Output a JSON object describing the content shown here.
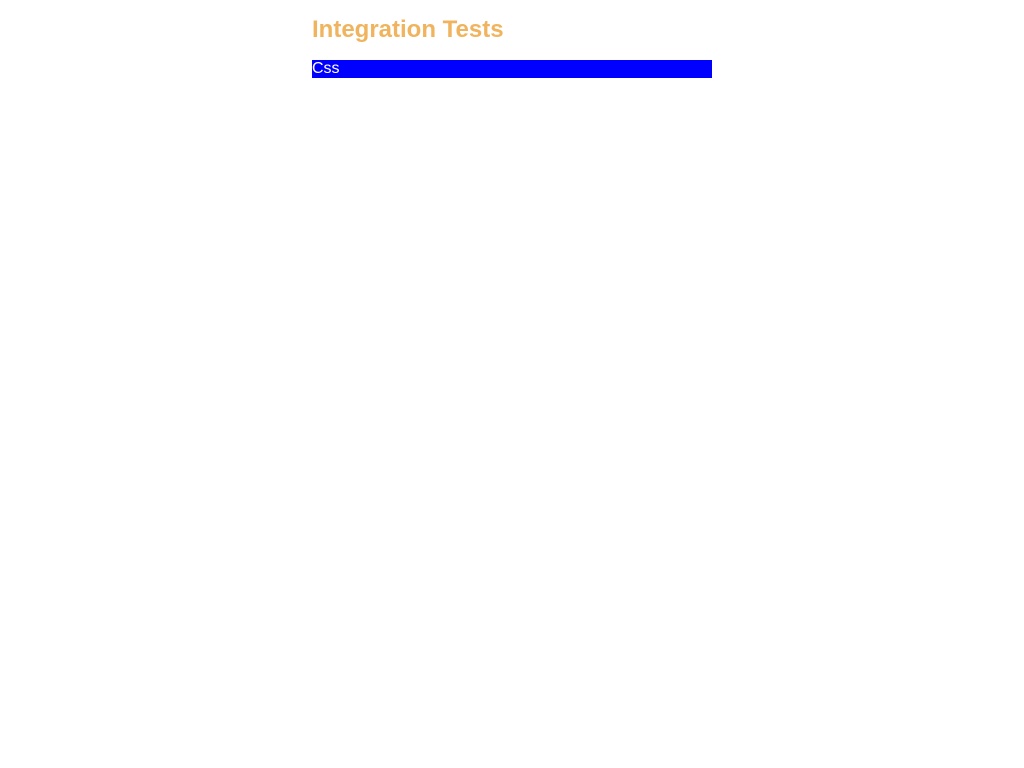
{
  "page": {
    "title": "Integration Tests"
  },
  "tests": {
    "items": [
      {
        "label": "Css",
        "color": "#0000ff"
      }
    ]
  },
  "colors": {
    "title": "#f0b45e",
    "text_on_bar": "#ffffff",
    "background": "#ffffff"
  }
}
